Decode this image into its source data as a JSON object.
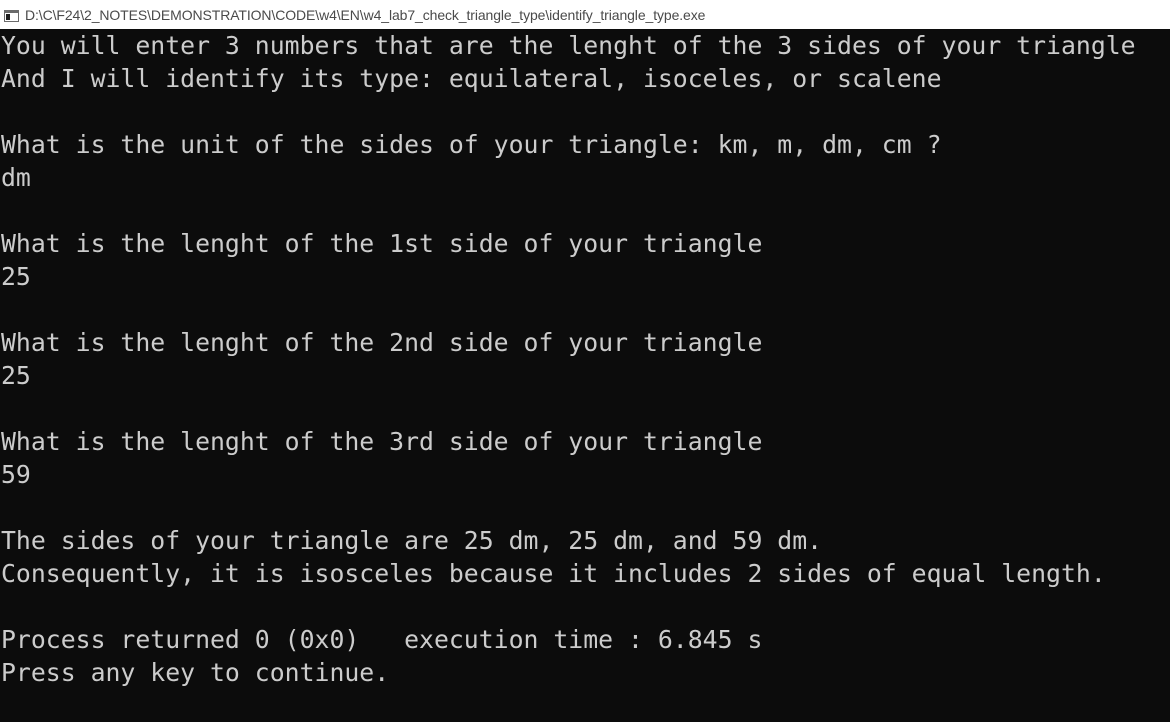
{
  "window": {
    "title": "D:\\C\\F24\\2_NOTES\\DEMONSTRATION\\CODE\\w4\\EN\\w4_lab7_check_triangle_type\\identify_triangle_type.exe",
    "icon": "console-app-icon"
  },
  "console": {
    "lines": [
      "You will enter 3 numbers that are the lenght of the 3 sides of your triangle",
      "And I will identify its type: equilateral, isoceles, or scalene",
      "",
      "What is the unit of the sides of your triangle: km, m, dm, cm ?",
      "dm",
      "",
      "What is the lenght of the 1st side of your triangle",
      "25",
      "",
      "What is the lenght of the 2nd side of your triangle",
      "25",
      "",
      "What is the lenght of the 3rd side of your triangle",
      "59",
      "",
      "The sides of your triangle are 25 dm, 25 dm, and 59 dm.",
      "Consequently, it is isosceles because it includes 2 sides of equal length.",
      "",
      "Process returned 0 (0x0)   execution time : 6.845 s",
      "Press any key to continue."
    ]
  },
  "colors": {
    "background": "#0c0c0c",
    "text": "#cccccc",
    "titlebar": "#ffffff"
  }
}
